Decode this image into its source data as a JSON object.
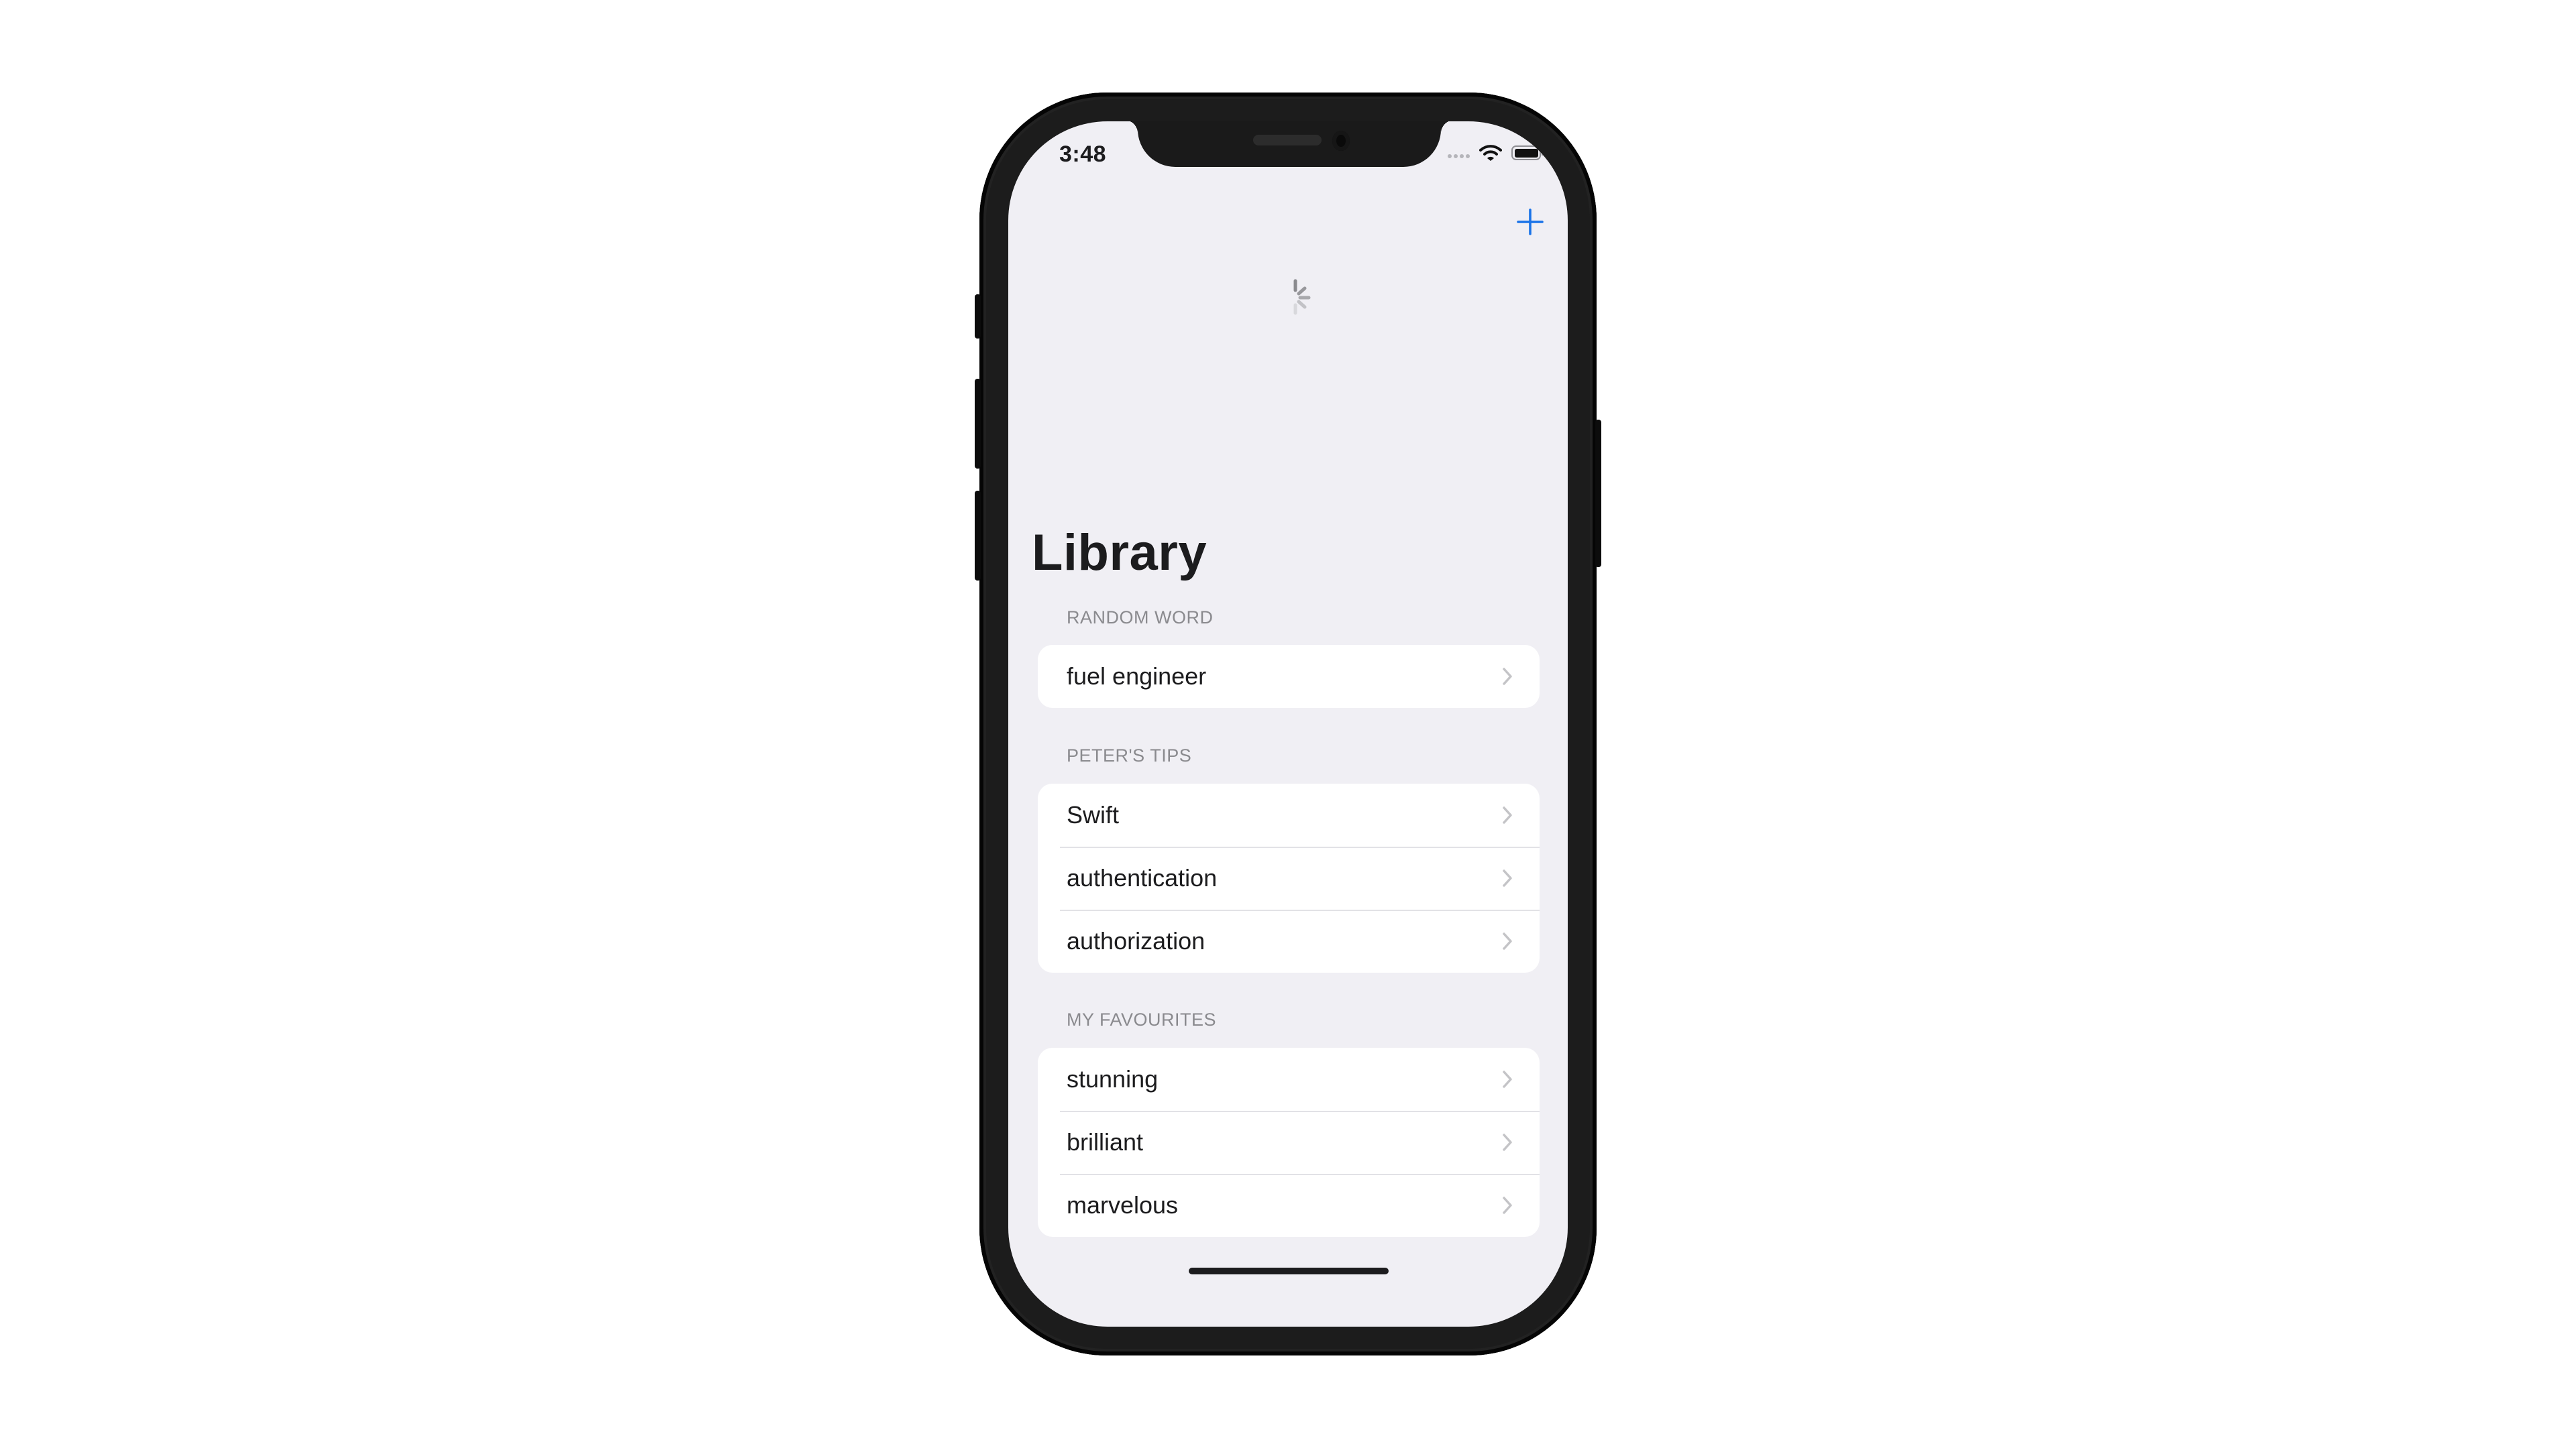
{
  "status_bar": {
    "time": "3:48",
    "cellular_icon": "cellular-no-signal-icon",
    "wifi_icon": "wifi-icon",
    "battery_icon": "battery-full-icon"
  },
  "nav": {
    "add_icon": "plus-icon",
    "accent_color": "#1a73e8",
    "loading_icon": "activity-spinner-icon",
    "title": "Library"
  },
  "sections": [
    {
      "header": "RANDOM WORD",
      "rows": [
        {
          "label": "fuel engineer"
        }
      ]
    },
    {
      "header": "PETER'S TIPS",
      "rows": [
        {
          "label": "Swift"
        },
        {
          "label": "authentication"
        },
        {
          "label": "authorization"
        }
      ]
    },
    {
      "header": "MY FAVOURITES",
      "rows": [
        {
          "label": "stunning"
        },
        {
          "label": "brilliant"
        },
        {
          "label": "marvelous"
        }
      ]
    }
  ]
}
